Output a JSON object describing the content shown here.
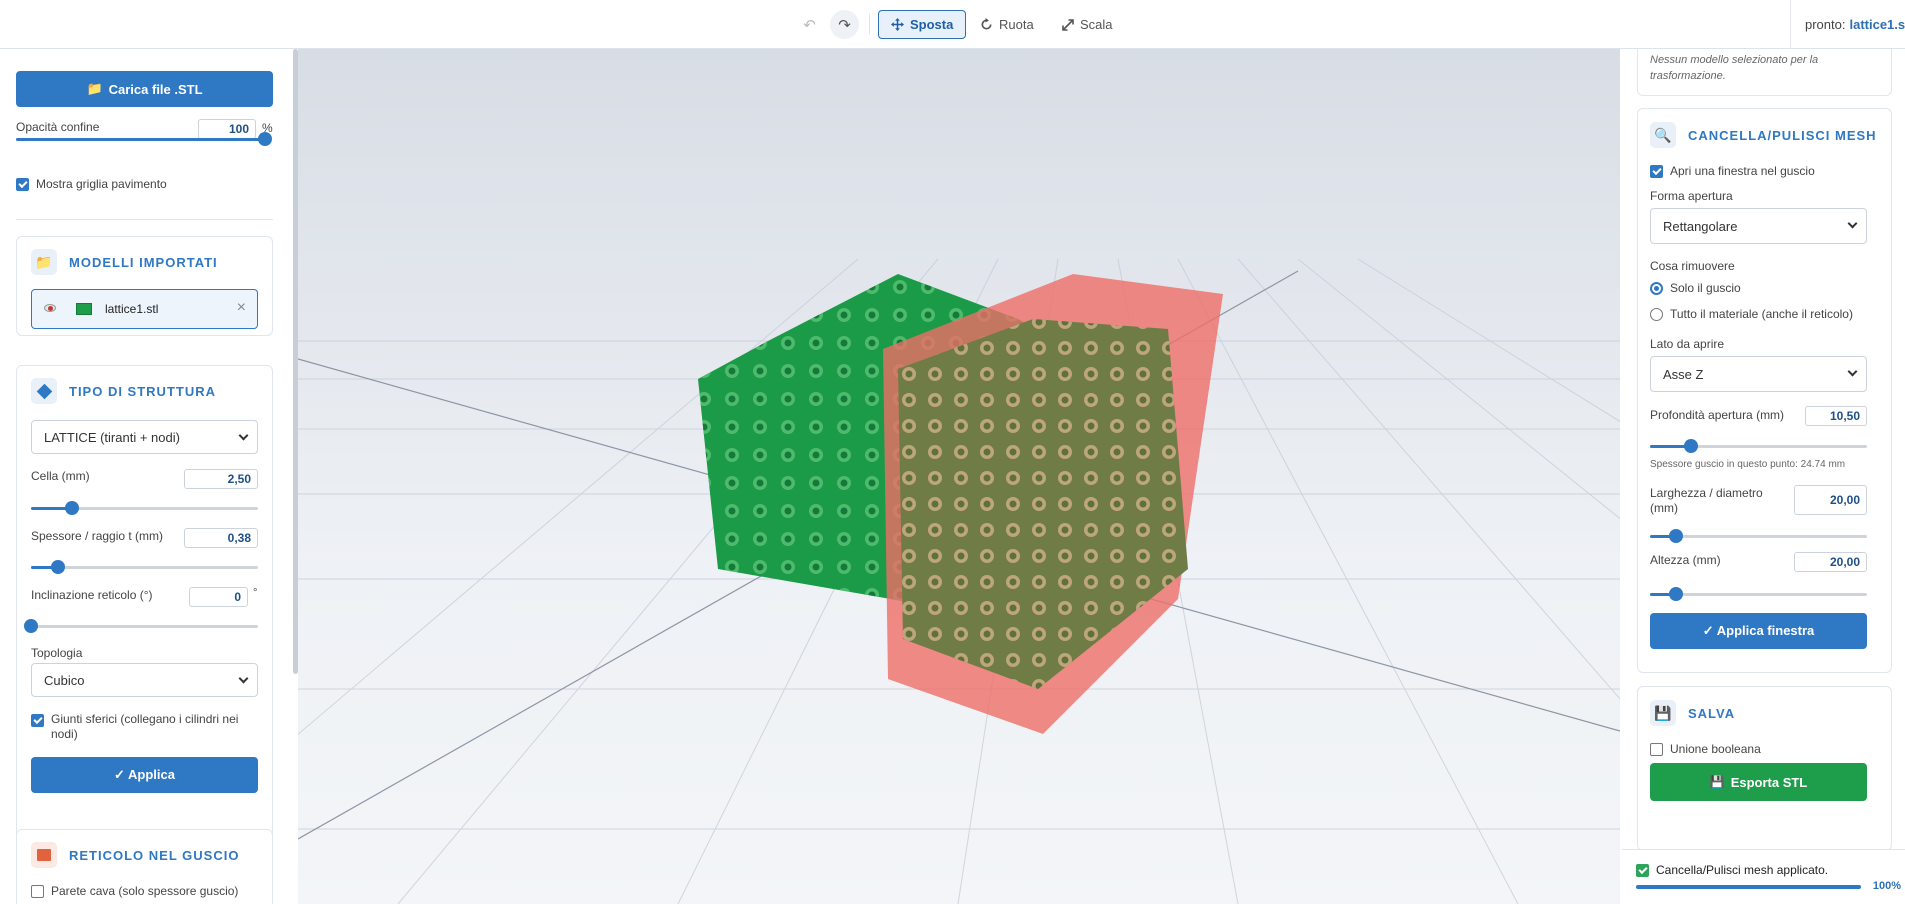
{
  "toolbar": {
    "undo_icon": "↶",
    "redo_icon": "↷",
    "tools": [
      {
        "label": "Sposta",
        "icon": "move-icon",
        "active": true
      },
      {
        "label": "Ruota",
        "icon": "rotate-icon",
        "active": false
      },
      {
        "label": "Scala",
        "icon": "scale-icon",
        "active": false
      }
    ],
    "status_label": "pronto:",
    "status_file": "lattice1.stl"
  },
  "left": {
    "load_button": "Carica file .STL",
    "opacity_label": "Opacità confine",
    "opacity_value": "100",
    "opacity_unit": "%",
    "opacity_level": 1.0,
    "floor_grid_label": "Mostra griglia pavimento",
    "floor_grid_checked": true,
    "models": {
      "title": "MODELLI IMPORTATI",
      "items": [
        {
          "name": "lattice1.stl",
          "color": "#1e9e4a"
        }
      ]
    },
    "structure": {
      "title": "TIPO DI STRUTTURA",
      "type_value": "LATTICE (tiranti + nodi)",
      "cell_label": "Cella (mm)",
      "cell_value": "2,50",
      "cell_level": 0.18,
      "thickness_label": "Spessore / raggio t (mm)",
      "thickness_value": "0,38",
      "thickness_level": 0.12,
      "tilt_label": "Inclinazione reticolo (°)",
      "tilt_value": "0",
      "tilt_unit": "°",
      "tilt_level": 0.0,
      "topology_label": "Topologia",
      "topology_value": "Cubico",
      "joints_label": "Giunti sferici (collegano i cilindri nei nodi)",
      "joints_checked": true,
      "apply_button": "✓ Applica"
    },
    "shell_lattice": {
      "title": "RETICOLO NEL GUSCIO",
      "hollow_label": "Parete cava (solo spessore guscio)",
      "hollow_checked": false
    }
  },
  "right": {
    "transform_note": "Nessun modello selezionato per la trasformazione.",
    "clean": {
      "title": "CANCELLA/PULISCI MESH",
      "window_label": "Apri una finestra nel guscio",
      "window_checked": true,
      "shape_label": "Forma apertura",
      "shape_value": "Rettangolare",
      "remove_label": "Cosa rimuovere",
      "remove_options": [
        "Solo il guscio",
        "Tutto il materiale (anche il reticolo)"
      ],
      "remove_selected": 0,
      "side_label": "Lato da aprire",
      "side_value": "Asse Z",
      "depth_label": "Profondità apertura (mm)",
      "depth_value": "10,50",
      "depth_level": 0.19,
      "shell_note": "Spessore guscio in questo punto: 24.74 mm",
      "width_label": "Larghezza / diametro (mm)",
      "width_value": "20,00",
      "width_level": 0.12,
      "height_label": "Altezza (mm)",
      "height_value": "20,00",
      "height_level": 0.12,
      "apply_button": "✓ Applica finestra"
    },
    "save": {
      "title": "SALVA",
      "boolean_label": "Unione booleana",
      "boolean_checked": false,
      "export_button": "Esporta STL"
    }
  },
  "toast": {
    "message": "Cancella/Pulisci mesh applicato.",
    "progress_text": "100%",
    "progress": 1.0
  },
  "colors": {
    "accent": "#2f78c4",
    "model_green": "#1e9e4a",
    "window_box": "#ee6e68"
  }
}
